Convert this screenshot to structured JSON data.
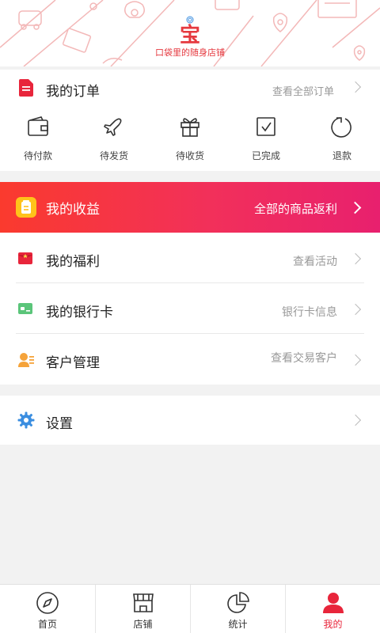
{
  "header": {
    "logo_char": "宝",
    "slogan": "口袋里的随身店铺"
  },
  "orders": {
    "title": "我的订单",
    "view_all": "查看全部订单",
    "items": [
      {
        "label": "待付款",
        "icon": "wallet-icon"
      },
      {
        "label": "待发货",
        "icon": "airplane-icon"
      },
      {
        "label": "待收货",
        "icon": "gift-icon"
      },
      {
        "label": "已完成",
        "icon": "checkbox-icon"
      },
      {
        "label": "退款",
        "icon": "refresh-icon"
      }
    ]
  },
  "earnings": {
    "title": "我的收益",
    "link": "全部的商品返利"
  },
  "menu": [
    {
      "title": "我的福利",
      "link": "查看活动",
      "icon": "red-envelope-icon"
    },
    {
      "title": "我的银行卡",
      "link": "银行卡信息",
      "icon": "bank-card-icon"
    },
    {
      "title": "客户管理",
      "link": "查看交易客户",
      "icon": "customer-icon"
    }
  ],
  "settings": {
    "title": "设置",
    "icon": "gear-icon"
  },
  "tabbar": {
    "tabs": [
      {
        "label": "首页",
        "icon": "compass-icon"
      },
      {
        "label": "店铺",
        "icon": "store-icon"
      },
      {
        "label": "统计",
        "icon": "pie-chart-icon"
      },
      {
        "label": "我的",
        "icon": "user-icon"
      }
    ],
    "active": "我的"
  },
  "colors": {
    "accent_red": "#e8253b",
    "earnings_gradient_start": "#fa3a2e",
    "earnings_gradient_end": "#e8206e",
    "coin_yellow": "#ffc21a",
    "bank_green": "#5bc57a",
    "settings_blue": "#3b8ee0"
  }
}
